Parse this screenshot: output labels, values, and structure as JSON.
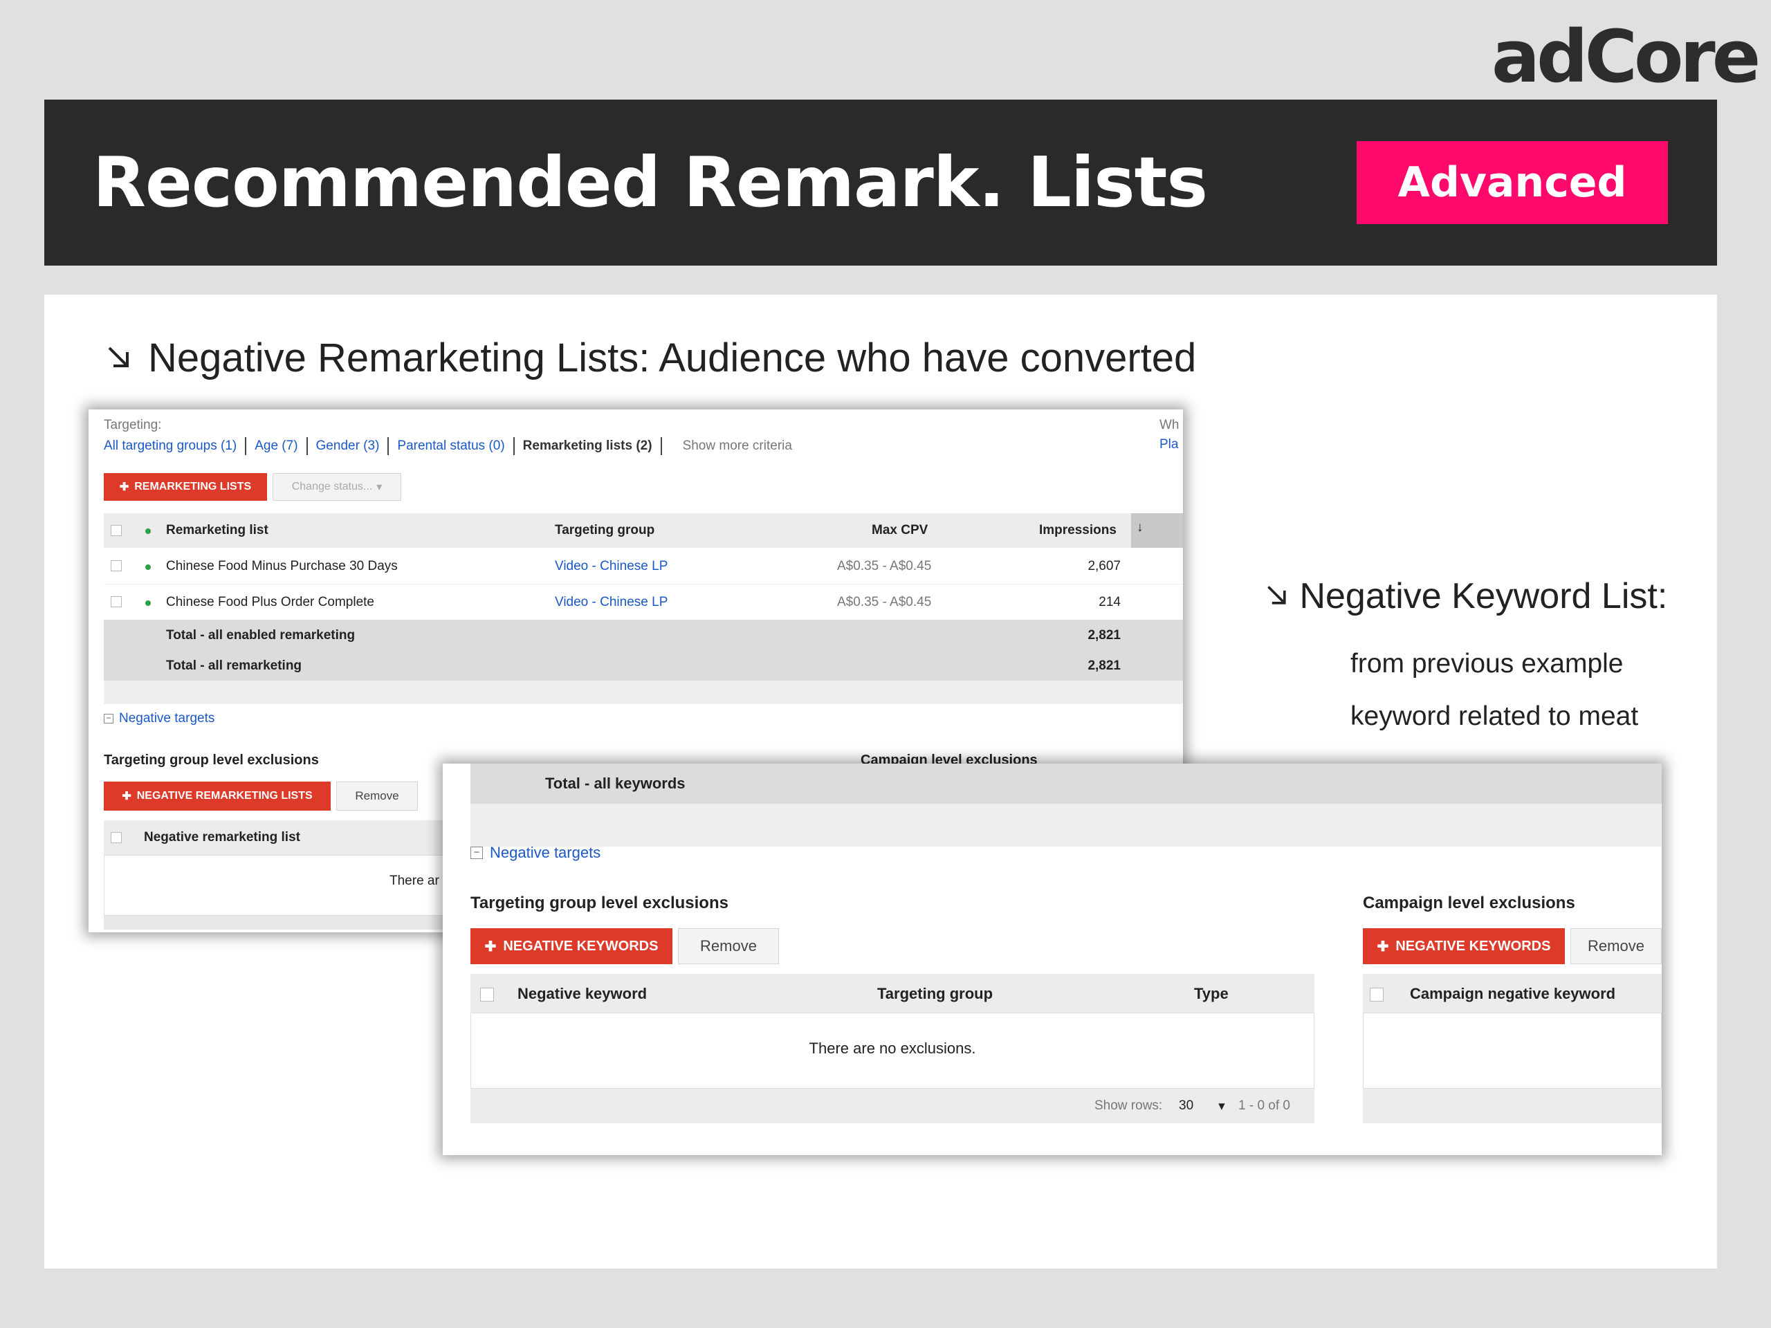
{
  "logo": "adCore",
  "banner": {
    "title": "Recommended Remark. Lists",
    "badge": "Advanced"
  },
  "bullets": {
    "main": "Negative Remarketing Lists: Audience who have converted",
    "side_title": "Negative Keyword List:",
    "side_lines": [
      "from previous example",
      "keyword related to meat"
    ]
  },
  "screenshot_a": {
    "targeting_label": "Targeting:",
    "tabs": [
      "All targeting groups (1)",
      "Age (7)",
      "Gender (3)",
      "Parental status (0)",
      "Remarketing lists (2)",
      "Show more criteria"
    ],
    "right_clip": [
      "Wh",
      "Pla"
    ],
    "add_button": "REMARKETING LISTS",
    "change_status": "Change status...",
    "columns": [
      "Remarketing list",
      "Targeting group",
      "Max CPV",
      "Impressions"
    ],
    "rows": [
      {
        "name": "Chinese Food Minus Purchase 30 Days",
        "group": "Video - Chinese LP",
        "cpv": "A$0.35 - A$0.45",
        "impressions": "2,607"
      },
      {
        "name": "Chinese Food Plus Order Complete",
        "group": "Video - Chinese LP",
        "cpv": "A$0.35 - A$0.45",
        "impressions": "214"
      }
    ],
    "totals": [
      {
        "label": "Total - all enabled remarketing",
        "value": "2,821"
      },
      {
        "label": "Total - all remarketing",
        "value": "2,821"
      }
    ],
    "negative_targets": "Negative targets",
    "group_exclusions": "Targeting group level exclusions",
    "campaign_exclusions": "Campaign level exclusions",
    "neg_button": "NEGATIVE REMARKETING LISTS",
    "remove": "Remove",
    "neg_col": "Negative remarketing list",
    "empty_clip": "There ar"
  },
  "screenshot_b": {
    "total_label": "Total - all keywords",
    "negative_targets": "Negative targets",
    "group_exclusions": "Targeting group level exclusions",
    "campaign_exclusions": "Campaign level exclusions",
    "neg_button": "NEGATIVE KEYWORDS",
    "remove": "Remove",
    "columns": [
      "Negative keyword",
      "Targeting group",
      "Type"
    ],
    "campaign_col": "Campaign negative keyword",
    "empty": "There are no exclusions.",
    "show_rows_label": "Show rows:",
    "show_rows_value": "30",
    "pagination": "1 - 0 of 0"
  }
}
